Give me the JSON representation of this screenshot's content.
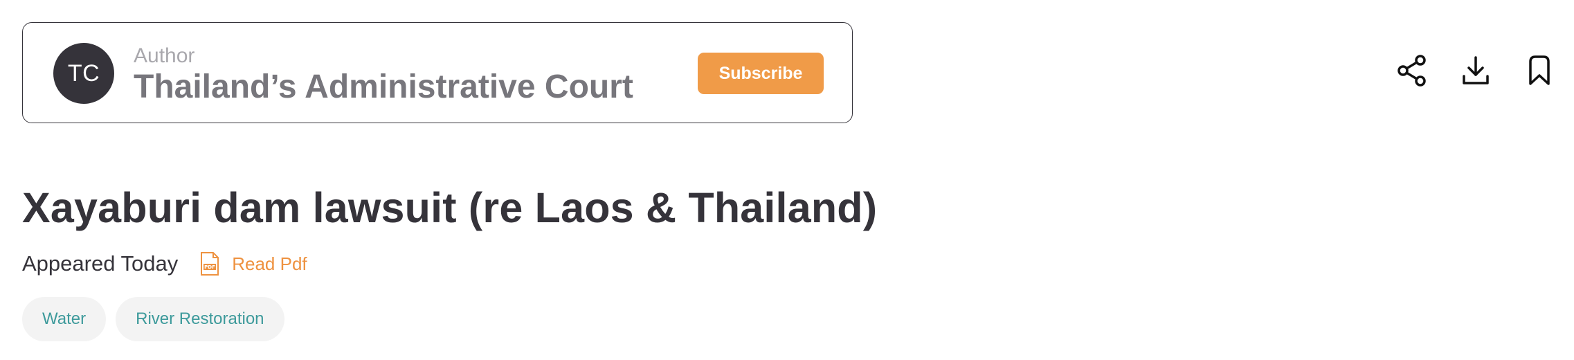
{
  "author": {
    "initials": "TC",
    "label": "Author",
    "name": "Thailand’s Administrative Court",
    "subscribe_label": "Subscribe"
  },
  "actions": {
    "icons": [
      "share-icon",
      "download-icon",
      "bookmark-icon"
    ]
  },
  "article": {
    "title": "Xayaburi dam lawsuit (re Laos & Thailand)",
    "appeared": "Appeared Today",
    "pdf_icon_text": "PDF",
    "read_pdf_label": "Read Pdf"
  },
  "tags": [
    {
      "label": "Water"
    },
    {
      "label": "River Restoration"
    }
  ],
  "colors": {
    "accent": "#f09b48",
    "dark": "#35333a",
    "tag_text": "#3d9a9b",
    "tag_bg": "#f3f3f3"
  }
}
